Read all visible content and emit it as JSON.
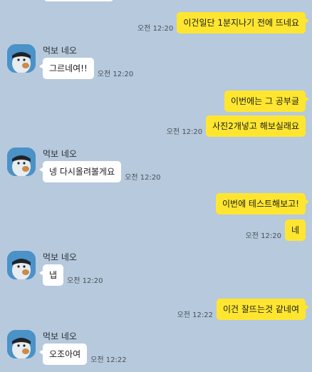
{
  "sender_name": "먹보 네오",
  "messages": [
    {
      "text": "이건일단 1분지나기 전에 뜨네요",
      "time": "오전 12:20"
    },
    {
      "text": "그르네여!!",
      "time": "오전 12:20"
    },
    {
      "text": "이번에는 그 공부글",
      "time": ""
    },
    {
      "text": "사진2개넣고 해보실래요",
      "time": "오전 12:20"
    },
    {
      "text": "넹 다시올려볼게요",
      "time": "오전 12:20"
    },
    {
      "text": "이번에 테스트해보고!",
      "time": ""
    },
    {
      "text": "네",
      "time": "오전 12:20"
    },
    {
      "text": "냅",
      "time": "오전 12:20"
    },
    {
      "text": "이건 잘뜨는것 같네여",
      "time": "오전 12:22"
    },
    {
      "text": "오조아여",
      "time": "오전 12:22"
    }
  ],
  "colors": {
    "background": "#b6c9dd",
    "outgoing_bubble": "#fee630",
    "incoming_bubble": "#ffffff",
    "avatar_bg": "#4a92c8"
  }
}
